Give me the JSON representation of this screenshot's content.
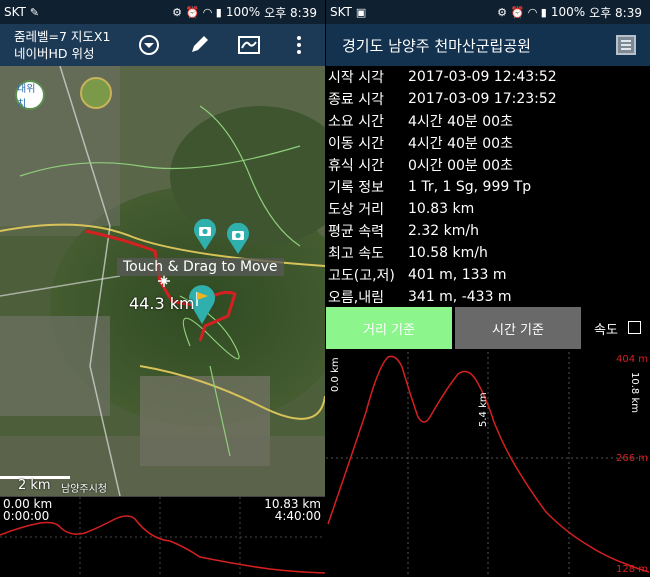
{
  "left": {
    "status": {
      "carrier": "SKT",
      "battery": "100%",
      "time": "오후 8:39"
    },
    "appbar": {
      "line1": "줌레벨=7 지도X1",
      "line2": "네이버HD 위성"
    },
    "map": {
      "location_button": "내위치",
      "overlay_text": "Touch & Drag to Move",
      "distance_label": "44.3 km",
      "scale_label": "2 km",
      "city_label": "남양주시청"
    },
    "graph": {
      "start_dist": "0.00 km",
      "start_time": "0:00:00",
      "end_dist": "10.83 km",
      "end_time": "4:40:00"
    }
  },
  "right": {
    "status": {
      "carrier": "SKT",
      "battery": "100%",
      "time": "오후 8:39"
    },
    "title": "경기도 남양주 천마산군립공원",
    "stats": [
      {
        "key": "시작 시각",
        "value": "2017-03-09 12:43:52"
      },
      {
        "key": "종료 시각",
        "value": "2017-03-09 17:23:52"
      },
      {
        "key": "소요 시간",
        "value": "4시간 40분 00초"
      },
      {
        "key": "이동 시간",
        "value": "4시간 40분 00초"
      },
      {
        "key": "휴식 시간",
        "value": "0시간 00분 00초"
      },
      {
        "key": "기록 정보",
        "value": "1 Tr, 1 Sg, 999 Tp"
      },
      {
        "key": "도상 거리",
        "value": "10.83 km"
      },
      {
        "key": "평균 속력",
        "value": "2.32 km/h"
      },
      {
        "key": "최고 속도",
        "value": "10.58 km/h"
      },
      {
        "key": "고도(고,저)",
        "value": "401 m, 133 m"
      },
      {
        "key": "오름,내림",
        "value": "341 m, -433 m"
      }
    ],
    "buttons": {
      "distance": "거리 기준",
      "time": "시간 기준",
      "speed": "속도"
    },
    "chart": {
      "x_start": "0.0 km",
      "x_mid": "5.4 km",
      "x_end": "10.8 km",
      "y_top": "404 m",
      "y_mid": "266 m",
      "y_bottom": "128 m"
    }
  },
  "colors": {
    "accent_green": "#8cf58c",
    "track_red": "#d42020",
    "appbar": "#1c3a55"
  }
}
